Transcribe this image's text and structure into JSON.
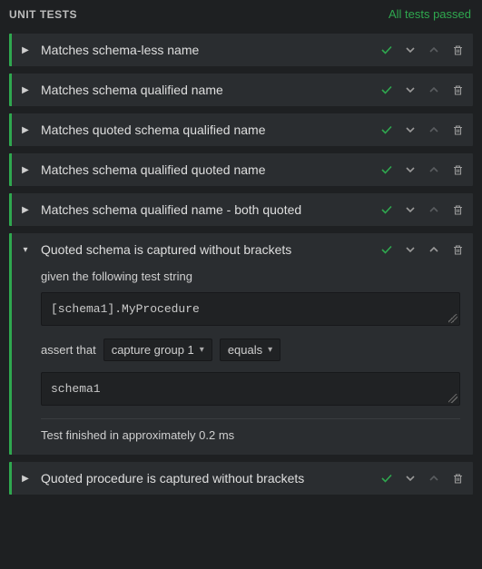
{
  "header": {
    "title": "UNIT TESTS",
    "status": "All tests passed"
  },
  "tests": [
    {
      "title": "Matches schema-less name",
      "pass": true,
      "expanded": false
    },
    {
      "title": "Matches schema qualified name",
      "pass": true,
      "expanded": false
    },
    {
      "title": "Matches quoted schema qualified name",
      "pass": true,
      "expanded": false
    },
    {
      "title": "Matches schema qualified quoted name",
      "pass": true,
      "expanded": false
    },
    {
      "title": "Matches schema qualified name - both quoted",
      "pass": true,
      "expanded": false
    },
    {
      "title": "Quoted schema is captured without brackets",
      "pass": true,
      "expanded": true,
      "detail": {
        "given_label": "given the following test string",
        "given_value": "[schema1].MyProcedure",
        "assert_prefix": "assert that",
        "assert_subject": "capture group 1",
        "assert_operator": "equals",
        "expected_value": "schema1",
        "finished_text": "Test finished in approximately 0.2 ms"
      }
    },
    {
      "title": "Quoted procedure is captured without brackets",
      "pass": true,
      "expanded": false
    }
  ],
  "icons": {
    "check": "check-icon",
    "down": "chevron-down-icon",
    "up": "chevron-up-icon",
    "trash": "trash-icon",
    "expand_right": "triangle-right-icon",
    "expand_down": "triangle-down-icon"
  }
}
